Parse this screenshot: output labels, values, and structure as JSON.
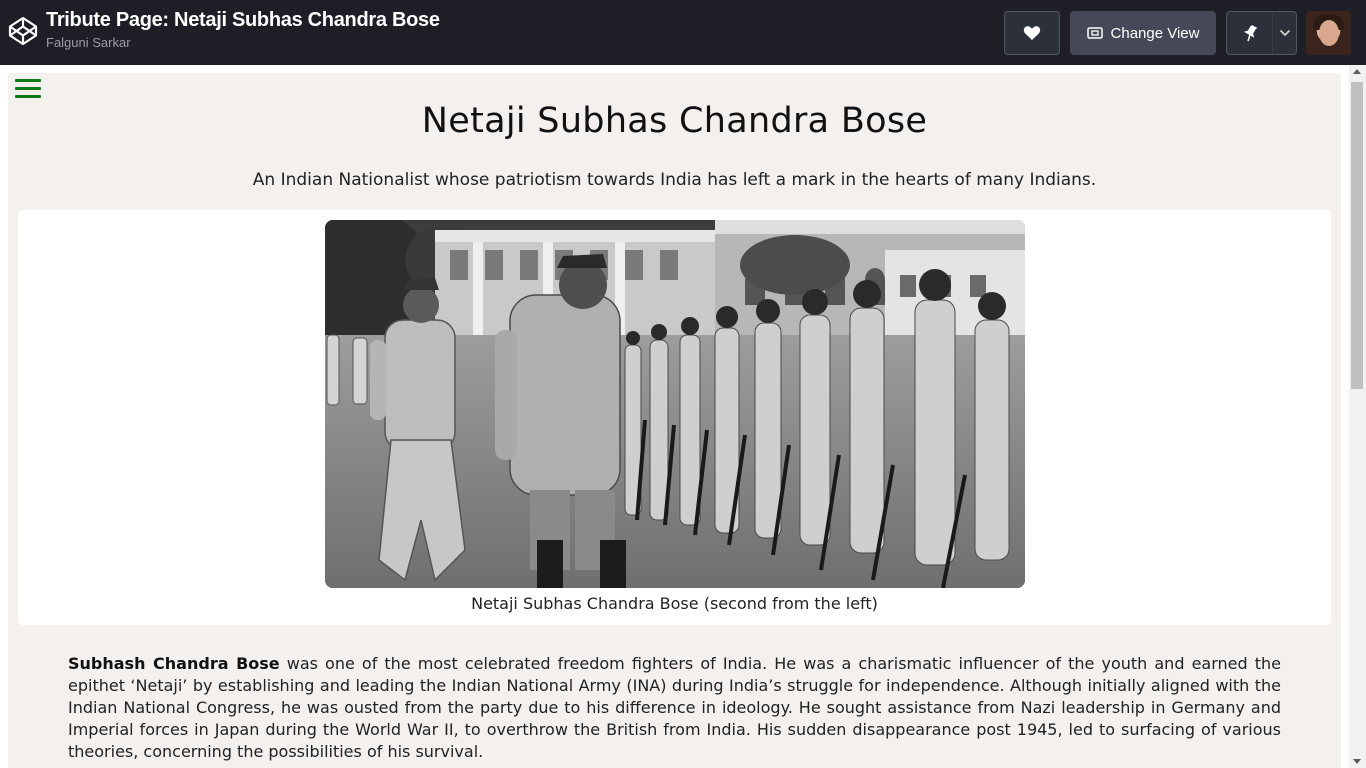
{
  "header": {
    "title": "Tribute Page: Netaji Subhas Chandra Bose",
    "author": "Falguni Sarkar",
    "change_view_label": "Change View",
    "logo_icon": "codepen-logo-icon",
    "heart_icon": "heart-icon",
    "view_icon": "change-view-icon",
    "pin_icon": "pin-icon",
    "dropdown_icon": "chevron-down-icon"
  },
  "page": {
    "menu_icon": "hamburger-menu-icon",
    "title": "Netaji Subhas Chandra Bose",
    "subtitle": "An Indian Nationalist whose patriotism towards India has left a mark in the hearts of many Indians.",
    "caption": "Netaji Subhas Chandra Bose (second from the left)",
    "bio_name": "Subhash Chandra Bose",
    "bio_text": " was one of the most celebrated freedom fighters of India. He was a charismatic influencer of the youth and earned the epithet ‘Netaji’ by establishing and leading the Indian National Army (INA) during India’s struggle for independence. Although initially aligned with the Indian National Congress, he was ousted from the party due to his difference in ideology. He sought assistance from Nazi leadership in Germany and Imperial forces in Japan during the World War II, to overthrow the British from India. His sudden disappearance post 1945, led to surfacing of various theories, concerning the possibilities of his survival."
  },
  "colors": {
    "header_bg": "#1e1f26",
    "page_bg": "#f3f0ee",
    "menu_green": "#0c7a13"
  }
}
